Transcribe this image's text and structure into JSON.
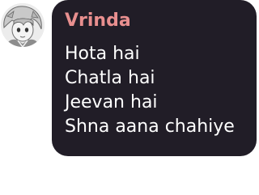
{
  "message": {
    "author": "Vrinda",
    "author_color": "#e88f8f",
    "avatar_icon": "anime-character-avatar",
    "lines": [
      "Hota hai",
      "Chatla hai",
      "Jeevan hai",
      "Shna aana chahiye"
    ],
    "bubble_color": "#211d27",
    "text_color": "#ffffff"
  }
}
